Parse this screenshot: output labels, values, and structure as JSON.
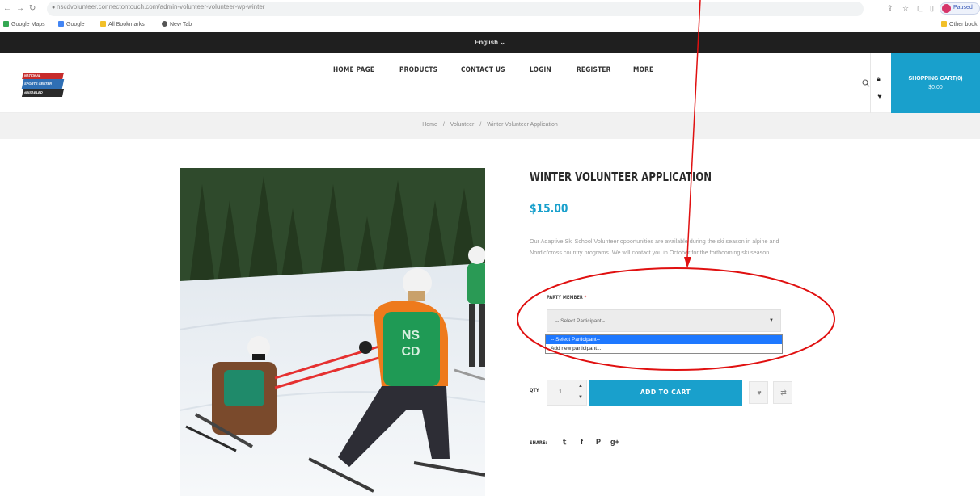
{
  "browser": {
    "url": "nscdvolunteer.connectontouch.com/admin-volunteer-volunteer-wp-winter",
    "profile_label": "Paused",
    "bookmarks": [
      "Google Maps",
      "Google",
      "All Bookmarks",
      "New Tab"
    ],
    "other_bookmarks": "Other book"
  },
  "site": {
    "language": "English",
    "logo_lines": [
      "NATIONAL",
      "SPORTS CENTER",
      "#DISABLED"
    ],
    "menu": [
      "HOME PAGE",
      "PRODUCTS",
      "CONTACT US",
      "LOGIN",
      "REGISTER",
      "MORE"
    ],
    "cart_label": "SHOPPING CART(0)",
    "cart_total": "$0.00"
  },
  "breadcrumb": [
    "Home",
    "Volunteer",
    "Winter Volunteer Application"
  ],
  "breadcrumb_sep": "/",
  "product": {
    "title": "WINTER VOLUNTEER APPLICATION",
    "price": "$15.00",
    "description": "Our Adaptive Ski School Volunteer opportunities are available during the ski season in alpine and Nordic/cross country programs. We will contact you in October for the forthcoming ski season.",
    "party_member_label": "PARTY MEMBER",
    "required_mark": "*",
    "select_value": "-- Select Participant--",
    "dropdown_options": [
      "-- Select Participant--",
      "Add new participant..."
    ],
    "qty_label": "QTY",
    "qty_value": "1",
    "add_to_cart": "ADD TO CART",
    "share_label": "SHARE:",
    "vest_text": [
      "NS",
      "CD"
    ]
  },
  "icons": {
    "back": "back-arrow-icon",
    "forward": "forward-arrow-icon",
    "reload": "reload-icon",
    "search": "search-icon",
    "lock": "lock-icon",
    "heart": "heart-icon",
    "wishlist": "heart-icon",
    "compare": "compare-icon",
    "twitter": "twitter-icon",
    "facebook": "facebook-icon",
    "pinterest": "pinterest-icon",
    "googleplus": "googleplus-icon"
  },
  "colors": {
    "accent": "#19a0cc",
    "topbar": "#1f1f1f",
    "annotation": "#e01010",
    "dropdown_highlight": "#1e78ff"
  }
}
